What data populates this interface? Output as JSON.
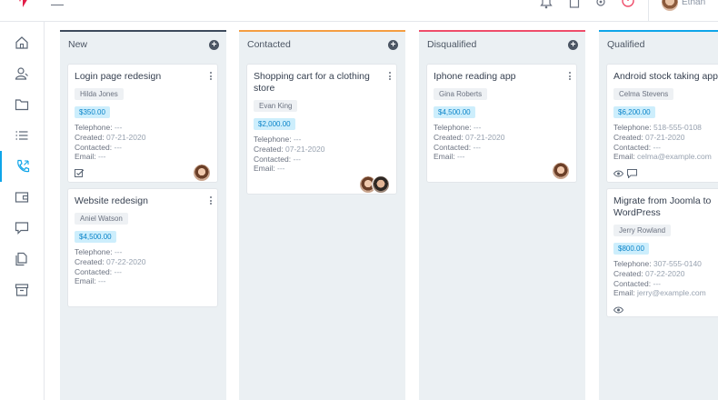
{
  "header": {
    "user_name": "Ethan"
  },
  "sidebar": {
    "items": [
      {
        "icon": "home-icon"
      },
      {
        "icon": "contacts-icon"
      },
      {
        "icon": "folder-icon"
      },
      {
        "icon": "list-icon"
      },
      {
        "icon": "phone-icon",
        "active": true
      },
      {
        "icon": "wallet-icon"
      },
      {
        "icon": "chat-icon"
      },
      {
        "icon": "documents-icon"
      },
      {
        "icon": "archive-icon"
      }
    ]
  },
  "labels": {
    "telephone": "Telephone:",
    "created": "Created:",
    "contacted": "Contacted:",
    "email": "Email:"
  },
  "columns": [
    {
      "title": "New",
      "color": "#3d4a5c",
      "cards": [
        {
          "title": "Login page redesign",
          "contact": "Hilda Jones",
          "amount": "$350.00",
          "telephone": "---",
          "created": "07-21-2020",
          "contacted": "---",
          "email": "---"
        },
        {
          "title": "Website redesign",
          "contact": "Aniel Watson",
          "amount": "$4,500.00",
          "telephone": "---",
          "created": "07-22-2020",
          "contacted": "---",
          "email": "---"
        }
      ]
    },
    {
      "title": "Contacted",
      "color": "#f59e42",
      "cards": [
        {
          "title": "Shopping cart for a clothing store",
          "contact": "Evan King",
          "amount": "$2,000.00",
          "telephone": "---",
          "created": "07-21-2020",
          "contacted": "---",
          "email": "---"
        }
      ]
    },
    {
      "title": "Disqualified",
      "color": "#ef4d6a",
      "cards": [
        {
          "title": "Iphone reading app",
          "contact": "Gina Roberts",
          "amount": "$4,500.00",
          "telephone": "---",
          "created": "07-21-2020",
          "contacted": "---",
          "email": "---"
        }
      ]
    },
    {
      "title": "Qualified",
      "color": "#0ea5e9",
      "cards": [
        {
          "title": "Android stock taking app",
          "contact": "Celma Stevens",
          "amount": "$6,200.00",
          "telephone": "518-555-0108",
          "created": "07-21-2020",
          "contacted": "---",
          "email": "celma@example.com"
        },
        {
          "title": "Migrate from Joomla to WordPress",
          "contact": "Jerry Rowland",
          "amount": "$800.00",
          "telephone": "307-555-0140",
          "created": "07-22-2020",
          "contacted": "---",
          "email": "jerry@example.com"
        }
      ]
    }
  ]
}
